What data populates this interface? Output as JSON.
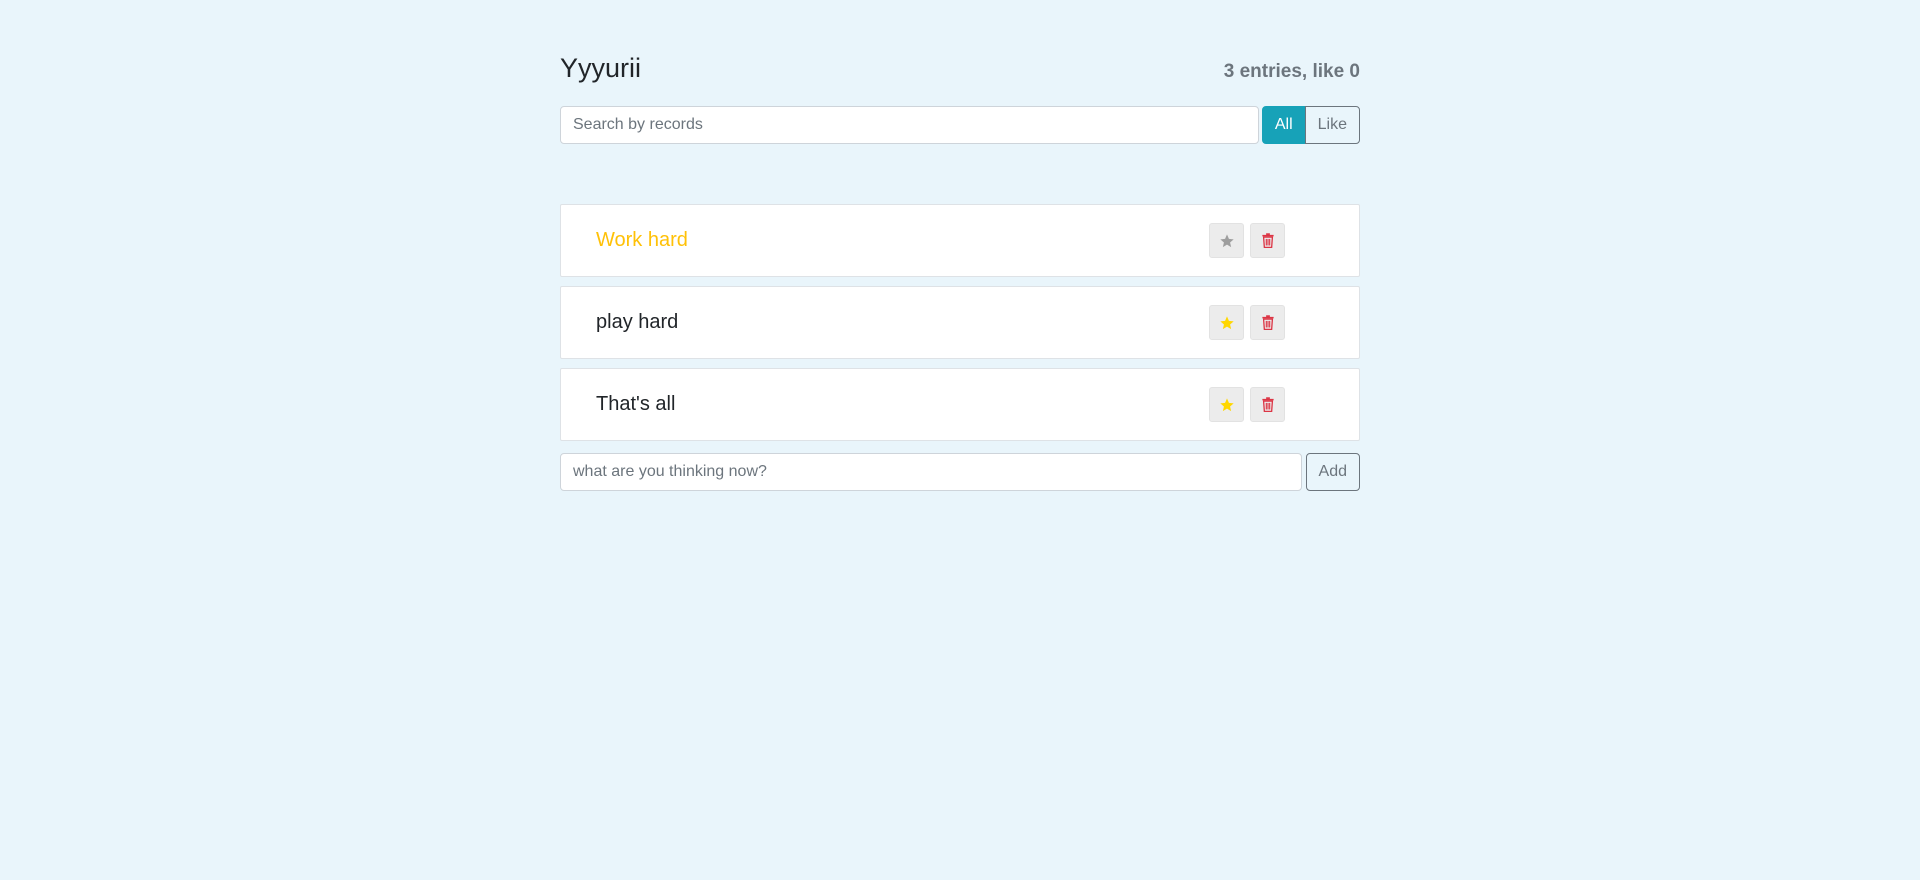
{
  "header": {
    "title": "Yyyurii",
    "counts": "3 entries, like 0"
  },
  "search": {
    "placeholder": "Search by records",
    "value": ""
  },
  "filters": {
    "all_label": "All",
    "like_label": "Like",
    "active": "All"
  },
  "items": [
    {
      "label": "Work hard",
      "important": true,
      "liked": false
    },
    {
      "label": "play hard",
      "important": false,
      "liked": true
    },
    {
      "label": "That's all",
      "important": false,
      "liked": true
    }
  ],
  "add_form": {
    "placeholder": "what are you thinking now?",
    "value": "",
    "button_label": "Add"
  },
  "icons": {
    "like": "star-icon",
    "delete": "trash-icon"
  },
  "colors": {
    "background": "#e9f5fb",
    "active_filter": "#17a2b8",
    "important_text": "#ffc107",
    "star_liked": "#ffd700",
    "star_unliked": "#9e9e9e",
    "delete": "#dc3545"
  }
}
